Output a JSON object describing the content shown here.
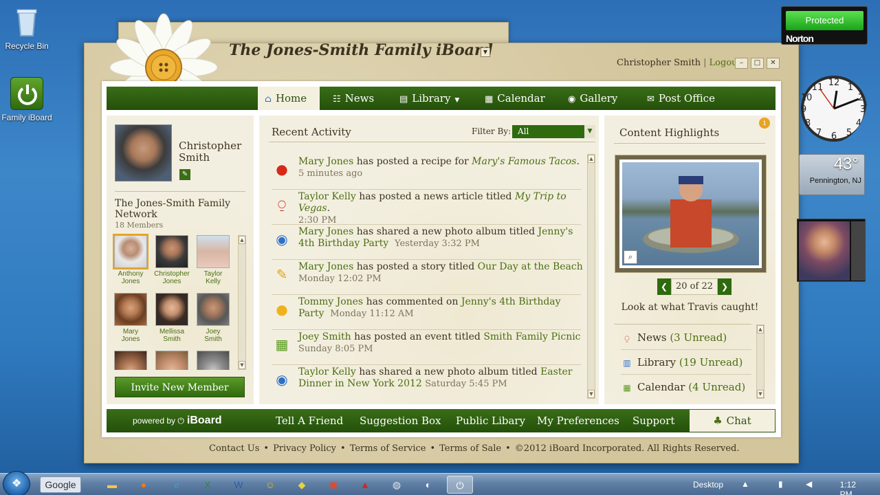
{
  "desktop": {
    "recycle_bin": "Recycle Bin",
    "family_iboard": "Family iBoard"
  },
  "app": {
    "title": "The Jones-Smith Family iBoard",
    "user_name": "Christopher Smith",
    "logout": "Logout"
  },
  "nav": {
    "items": [
      {
        "label": "Home",
        "icon": "home-icon",
        "active": true
      },
      {
        "label": "News",
        "icon": "news-icon"
      },
      {
        "label": "Library",
        "icon": "book-icon"
      },
      {
        "label": "Calendar",
        "icon": "calendar-icon"
      },
      {
        "label": "Gallery",
        "icon": "camera-icon"
      },
      {
        "label": "Post Office",
        "icon": "envelope-icon"
      }
    ]
  },
  "profile": {
    "first": "Christopher",
    "last": "Smith",
    "network_title": "The Jones-Smith Family Network",
    "member_count": "18 Members",
    "members": [
      {
        "first": "Anthony",
        "last": "Jones"
      },
      {
        "first": "Christopher",
        "last": "Jones"
      },
      {
        "first": "Taylor",
        "last": "Kelly"
      },
      {
        "first": "Mary",
        "last": "Jones"
      },
      {
        "first": "Mellissa",
        "last": "Smith"
      },
      {
        "first": "Joey",
        "last": "Smith"
      }
    ],
    "invite_label": "Invite New Member"
  },
  "activity": {
    "title": "Recent Activity",
    "filter_label": "Filter By:",
    "filter_value": "All",
    "items": [
      {
        "who": "Mary Jones",
        "action": " has posted a recipe for ",
        "object": "Mary's Famous Tacos",
        "tail": ".",
        "time": "5 minutes ago"
      },
      {
        "who": "Taylor Kelly",
        "action": " has posted a news article titled ",
        "object": "My Trip to Vegas",
        "tail": ".",
        "time": "2:30 PM"
      },
      {
        "who": "Mary Jones",
        "action": " has shared a new photo album titled  ",
        "object": "Jenny's 4th Birthday Party",
        "tail": "",
        "time": "Yesterday 3:32 PM"
      },
      {
        "who": "Mary Jones",
        "action": " has posted a story titled ",
        "object": "Our Day at the Beach",
        "tail": "",
        "time": "Monday 12:02 PM"
      },
      {
        "who": "Tommy Jones",
        "action": " has commented on ",
        "object": "Jenny's 4th Birthday Party",
        "tail": "",
        "time": "Monday  11:12 AM"
      },
      {
        "who": "Joey Smith",
        "action": " has posted an event titled ",
        "object": "Smith Family Picnic",
        "tail": "",
        "time": "Sunday 8:05 PM"
      },
      {
        "who": "Taylor Kelly",
        "action": " has shared a new photo album titled  ",
        "object": "Easter Dinner in New York 2012",
        "tail": "",
        "time": "Saturday 5:45 PM"
      }
    ]
  },
  "highlights": {
    "title": "Content Highlights",
    "counter": "20 of 22",
    "caption": "Look at what Travis caught!",
    "items": [
      {
        "label": "News",
        "count": "(3 Unread)"
      },
      {
        "label": "Library",
        "count": "(19 Unread)"
      },
      {
        "label": "Calendar",
        "count": "(4 Unread)"
      }
    ]
  },
  "footer": {
    "powered_by": "powered by",
    "brand": "iBoard",
    "links": [
      "Tell A Friend",
      "Suggestion Box",
      "Public Libary",
      "My Preferences",
      "Support"
    ],
    "chat": "Chat",
    "bottom_links": [
      "Contact Us",
      "Privacy Policy",
      "Terms of Service",
      "Terms of Sale"
    ],
    "copyright": "©2012 iBoard Incorporated. All Rights Reserved."
  },
  "gadgets": {
    "norton_status": "Protected",
    "norton_brand": "Norton",
    "temp": "43°",
    "city": "Pennington, NJ"
  },
  "taskbar": {
    "google": "Google",
    "desktop": "Desktop",
    "time": "1:12 PM"
  },
  "colors": {
    "accent_green": "#2f6a0e",
    "link_green": "#4a6e12",
    "paper": "#d7cba6"
  }
}
